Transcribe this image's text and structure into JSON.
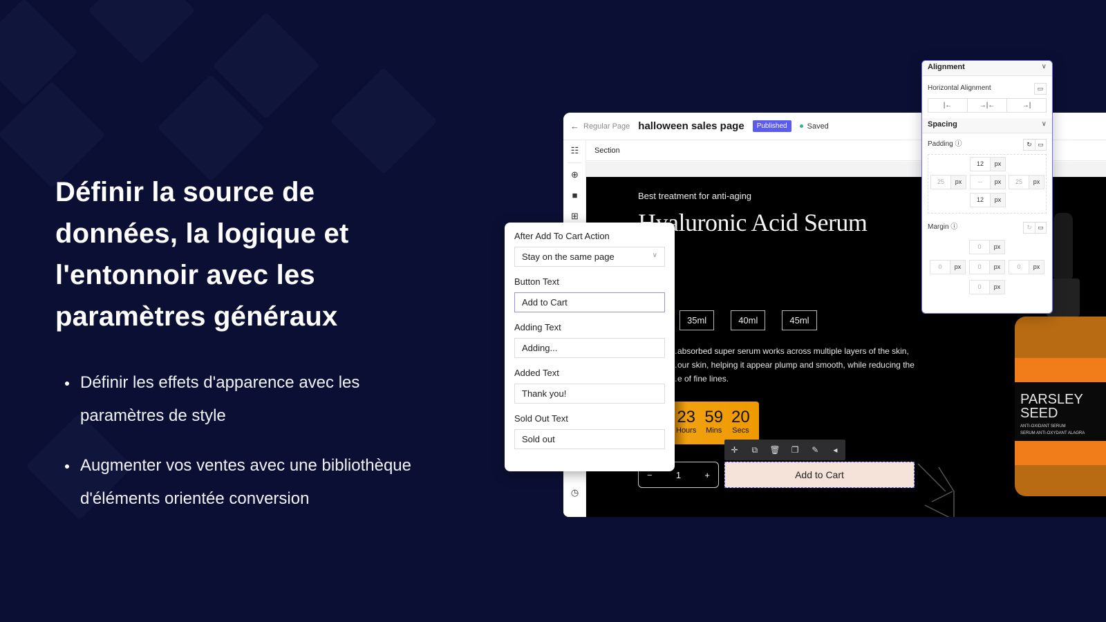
{
  "left": {
    "headline": "Définir la source de données, la logique et l'entonnoir avec les paramètres généraux",
    "bullets": [
      "Définir les effets d'apparence avec les paramètres de style",
      "Augmenter vos ventes avec une bibliothèque d'éléments orientée conversion"
    ]
  },
  "editor": {
    "back_icon": "arrow-left-icon",
    "breadcrumb": "Regular Page",
    "page_title": "halloween sales page",
    "status_badge": "Published",
    "save_status": "Saved",
    "section_label": "Section",
    "rail_icons": [
      "sitemap-icon",
      "add-circle-icon",
      "shopify-bag-icon",
      "grid-icon",
      "history-icon"
    ]
  },
  "product": {
    "tagline": "Best treatment for anti-aging",
    "title": "Hyaluronic Acid Serum",
    "variants": [
      "35ml",
      "40ml",
      "45ml"
    ],
    "description": "…absorbed super serum works across multiple layers of the skin, …our skin, helping it appear plump and smooth, while reducing the …e of fine lines.",
    "countdown": [
      {
        "value": "23",
        "label": "Hours"
      },
      {
        "value": "59",
        "label": "Mins"
      },
      {
        "value": "20",
        "label": "Secs"
      }
    ],
    "quantity": "1",
    "qty_minus": "−",
    "qty_plus": "+",
    "add_to_cart": "Add to Cart",
    "bottle_label_title": "PARSLEY SEED",
    "bottle_label_sub1": "ANTI-OXIDANT SERUM",
    "bottle_label_sub2": "SERUM ANTI-OXYDANT ALAGRA"
  },
  "element_toolbar": [
    "move-icon",
    "duplicate-icon",
    "delete-icon",
    "copy-icon",
    "style-icon",
    "collapse-icon"
  ],
  "cart_settings": {
    "after_action_label": "After Add To Cart Action",
    "after_action_value": "Stay on the same page",
    "button_text_label": "Button Text",
    "button_text_value": "Add to Cart",
    "adding_text_label": "Adding Text",
    "adding_text_value": "Adding...",
    "added_text_label": "Added Text",
    "added_text_value": "Thank you!",
    "sold_out_label": "Sold Out Text",
    "sold_out_value": "Sold out"
  },
  "style_panel": {
    "alignment_title": "Alignment",
    "horizontal_alignment": "Horizontal Alignment",
    "align_options": [
      "left",
      "center",
      "right"
    ],
    "spacing_title": "Spacing",
    "padding_label": "Padding",
    "padding": {
      "top": "12",
      "right": "25",
      "bottom": "12",
      "left": "25",
      "center": "--",
      "unit": "px"
    },
    "margin_label": "Margin",
    "margin": {
      "top": "0",
      "right": "0",
      "bottom": "0",
      "left": "0",
      "center": "0",
      "unit": "px"
    }
  }
}
